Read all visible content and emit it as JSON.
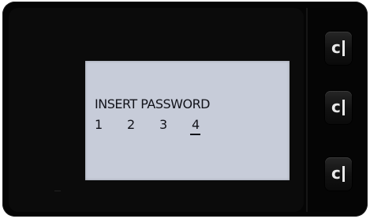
{
  "display": {
    "prompt": "INSERT PASSWORD",
    "digits": [
      "1",
      "2",
      "3",
      "4"
    ],
    "cursor_digit": "4"
  },
  "softkeys": [
    {
      "glyph": "c",
      "icon": "softkey-c-icon"
    },
    {
      "glyph": "c",
      "icon": "softkey-c-icon"
    },
    {
      "glyph": "c",
      "icon": "softkey-c-icon"
    }
  ],
  "colors": {
    "device_body": "#050505",
    "lcd_background": "#c7ccd9",
    "lcd_text": "#12131a",
    "softkey_glyph": "#e9e9e9"
  }
}
